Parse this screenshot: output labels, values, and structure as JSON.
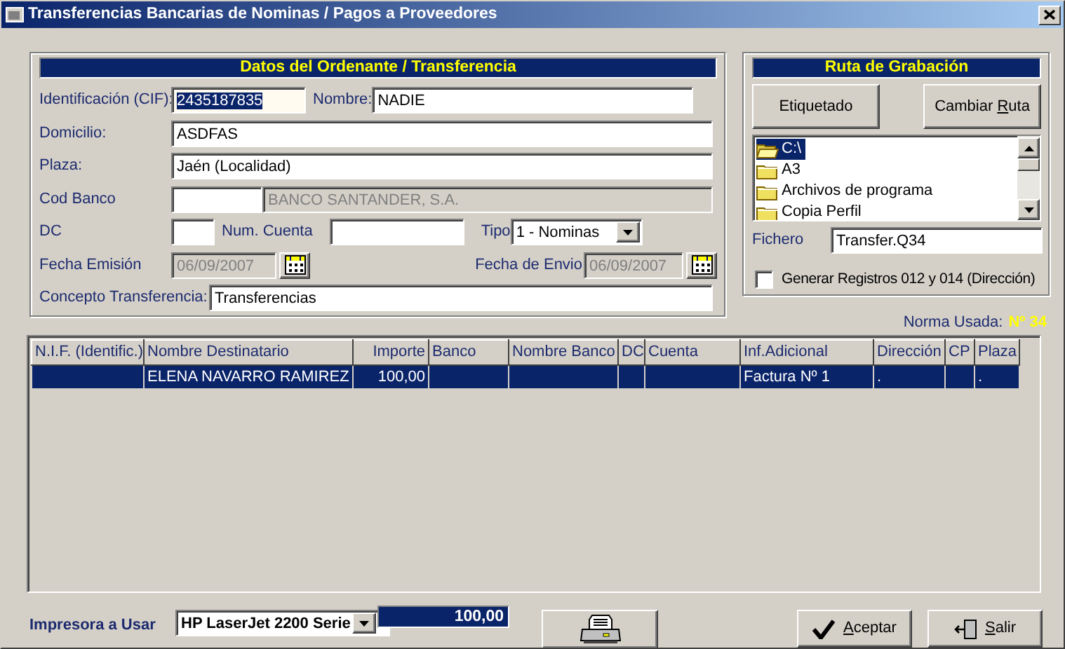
{
  "window": {
    "title": "Transferencias Bancarias de Nominas / Pagos a Proveedores"
  },
  "ordenante": {
    "title": "Datos del Ordenante / Transferencia",
    "cif": {
      "label": "Identificación (CIF):",
      "value": "2435187835",
      "text_selected": true
    },
    "nombre": {
      "label": "Nombre:",
      "value": "NADIE"
    },
    "domicilio": {
      "label": "Domicilio:",
      "value": "ASDFAS"
    },
    "plaza": {
      "label": "Plaza:",
      "value": "Jaén (Localidad)"
    },
    "cod_banco": {
      "label": "Cod Banco",
      "bank_name": "BANCO SANTANDER, S.A.",
      "bank_name_disabled": true
    },
    "dc": {
      "label": "DC"
    },
    "num_cuenta": {
      "label": "Num. Cuenta"
    },
    "tipo": {
      "label": "Tipo",
      "value": "1 - Nominas"
    },
    "fecha_emision": {
      "label": "Fecha Emisión",
      "value": "06/09/2007",
      "disabled": true
    },
    "fecha_envio": {
      "label": "Fecha de Envio",
      "value": "06/09/2007",
      "disabled": true
    },
    "concepto": {
      "label": "Concepto Transferencia:",
      "value": "Transferencias"
    }
  },
  "ruta": {
    "title": "Ruta de Grabación",
    "buttons": [
      {
        "text": "Etiquetado"
      },
      {
        "before": "Cambiar ",
        "key": "R",
        "after": "uta"
      }
    ],
    "folders": [
      {
        "name": "C:\\",
        "open": true,
        "selected": true
      },
      {
        "name": "A3",
        "open": false,
        "selected": false
      },
      {
        "name": "Archivos de programa",
        "open": false,
        "selected": false
      },
      {
        "name": "Copia Perfil",
        "open": false,
        "selected": false
      }
    ],
    "fichero": {
      "label": "Fichero",
      "value": "Transfer.Q34"
    },
    "generar": {
      "label": "Generar Registros 012 y 014 (Dirección)",
      "checked": false
    }
  },
  "norma": {
    "label": "Norma Usada:",
    "value": "Nº 34"
  },
  "table": {
    "columns": [
      "N.I.F. (Identific.)",
      "Nombre Destinatario",
      "Importe",
      "Banco",
      "Nombre Banco",
      "DC",
      "Cuenta",
      "Inf.Adicional",
      "Dirección",
      "CP",
      "Plaza"
    ],
    "rows": [
      {
        "selected": true,
        "cells": [
          {},
          {
            "text": "ELENA NAVARRO RAMIREZ"
          },
          {
            "text": "100,00"
          },
          {},
          {},
          {},
          {},
          {
            "text": "Factura Nº 1"
          },
          {
            "text": "."
          },
          {},
          {
            "text": "."
          }
        ]
      }
    ]
  },
  "bottom": {
    "impresora": {
      "label": "Impresora a Usar",
      "value": "HP LaserJet 2200 Serie"
    },
    "total": "100,00",
    "aceptar": {
      "key": "A",
      "after": "ceptar"
    },
    "salir": {
      "key": "S",
      "after": "alir"
    }
  }
}
